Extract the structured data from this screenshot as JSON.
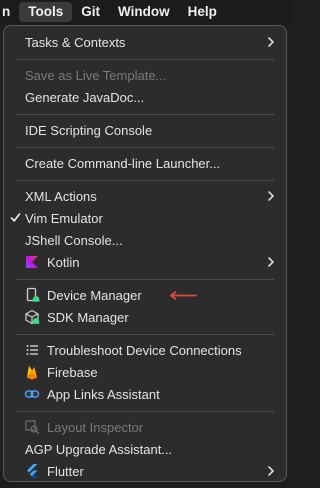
{
  "menubar": {
    "items": [
      "n",
      "Tools",
      "Git",
      "Window",
      "Help"
    ],
    "active": "Tools"
  },
  "menu": {
    "tasks_contexts": "Tasks & Contexts",
    "save_live_template": "Save as Live Template...",
    "generate_javadoc": "Generate JavaDoc...",
    "ide_scripting_console": "IDE Scripting Console",
    "create_cli_launcher": "Create Command-line Launcher...",
    "xml_actions": "XML Actions",
    "vim_emulator": "Vim Emulator",
    "vim_emulator_checked": true,
    "jshell_console": "JShell Console...",
    "kotlin": "Kotlin",
    "device_manager": "Device Manager",
    "sdk_manager": "SDK Manager",
    "troubleshoot": "Troubleshoot Device Connections",
    "firebase": "Firebase",
    "app_links": "App Links Assistant",
    "layout_inspector": "Layout Inspector",
    "agp_upgrade": "AGP Upgrade Assistant...",
    "flutter": "Flutter"
  },
  "colors": {
    "menu_bg": "#2c2c2c",
    "text": "#e4e4e4",
    "disabled_text": "#7a7a7a",
    "annotation_arrow": "#e0463a",
    "kotlin_purple": "#7f52ff",
    "device_green": "#3ddc84",
    "firebase_orange": "#ffa000",
    "app_links_blue": "#4d9fff",
    "flutter_blue": "#42a5f5"
  }
}
